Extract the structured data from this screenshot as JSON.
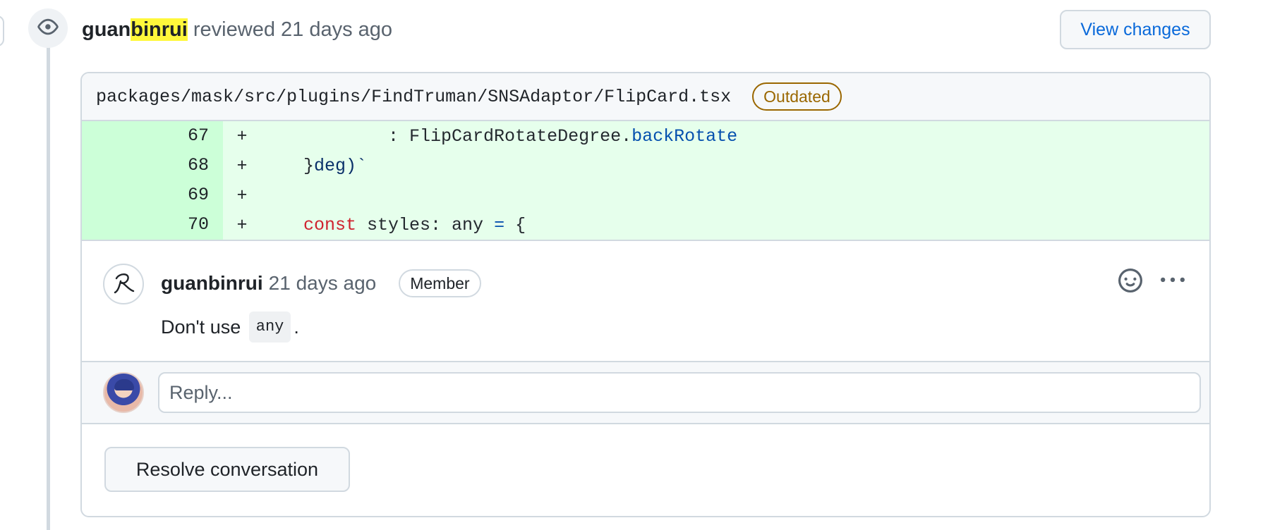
{
  "review": {
    "author_prefix": "guan",
    "author_highlight": "binrui",
    "action": "reviewed",
    "time": "21 days ago",
    "view_changes_label": "View changes"
  },
  "file": {
    "path": "packages/mask/src/plugins/FindTruman/SNSAdaptor/FlipCard.tsx",
    "badge": "Outdated"
  },
  "diff": {
    "lines": [
      {
        "num": "67",
        "sign": "+",
        "indent": "            ",
        "text": ": FlipCardRotateDegree.",
        "token": "backRotate"
      },
      {
        "num": "68",
        "sign": "+",
        "indent": "    ",
        "text": "}",
        "token": "deg)`"
      },
      {
        "num": "69",
        "sign": "+",
        "indent": "",
        "text": "",
        "token": ""
      },
      {
        "num": "70",
        "sign": "+",
        "indent": "    ",
        "keyword": "const",
        "text": " styles: any ",
        "op": "=",
        "tail": " {"
      }
    ]
  },
  "comment": {
    "author": "guanbinrui",
    "time": "21 days ago",
    "role_badge": "Member",
    "body_prefix": "Don't use",
    "body_code": "any",
    "body_suffix": "."
  },
  "reply": {
    "placeholder": "Reply..."
  },
  "resolve": {
    "label": "Resolve conversation"
  },
  "icons": {
    "review": "eye-icon",
    "avatar": "signature-avatar",
    "emoji": "smiley-icon",
    "more": "kebab-horizontal-icon"
  },
  "colors": {
    "link": "#0969da",
    "outdated": "#9a6700",
    "diff_add_bg": "#e6ffec",
    "diff_add_num_bg": "#ccffd8",
    "highlight": "#fff83b"
  }
}
